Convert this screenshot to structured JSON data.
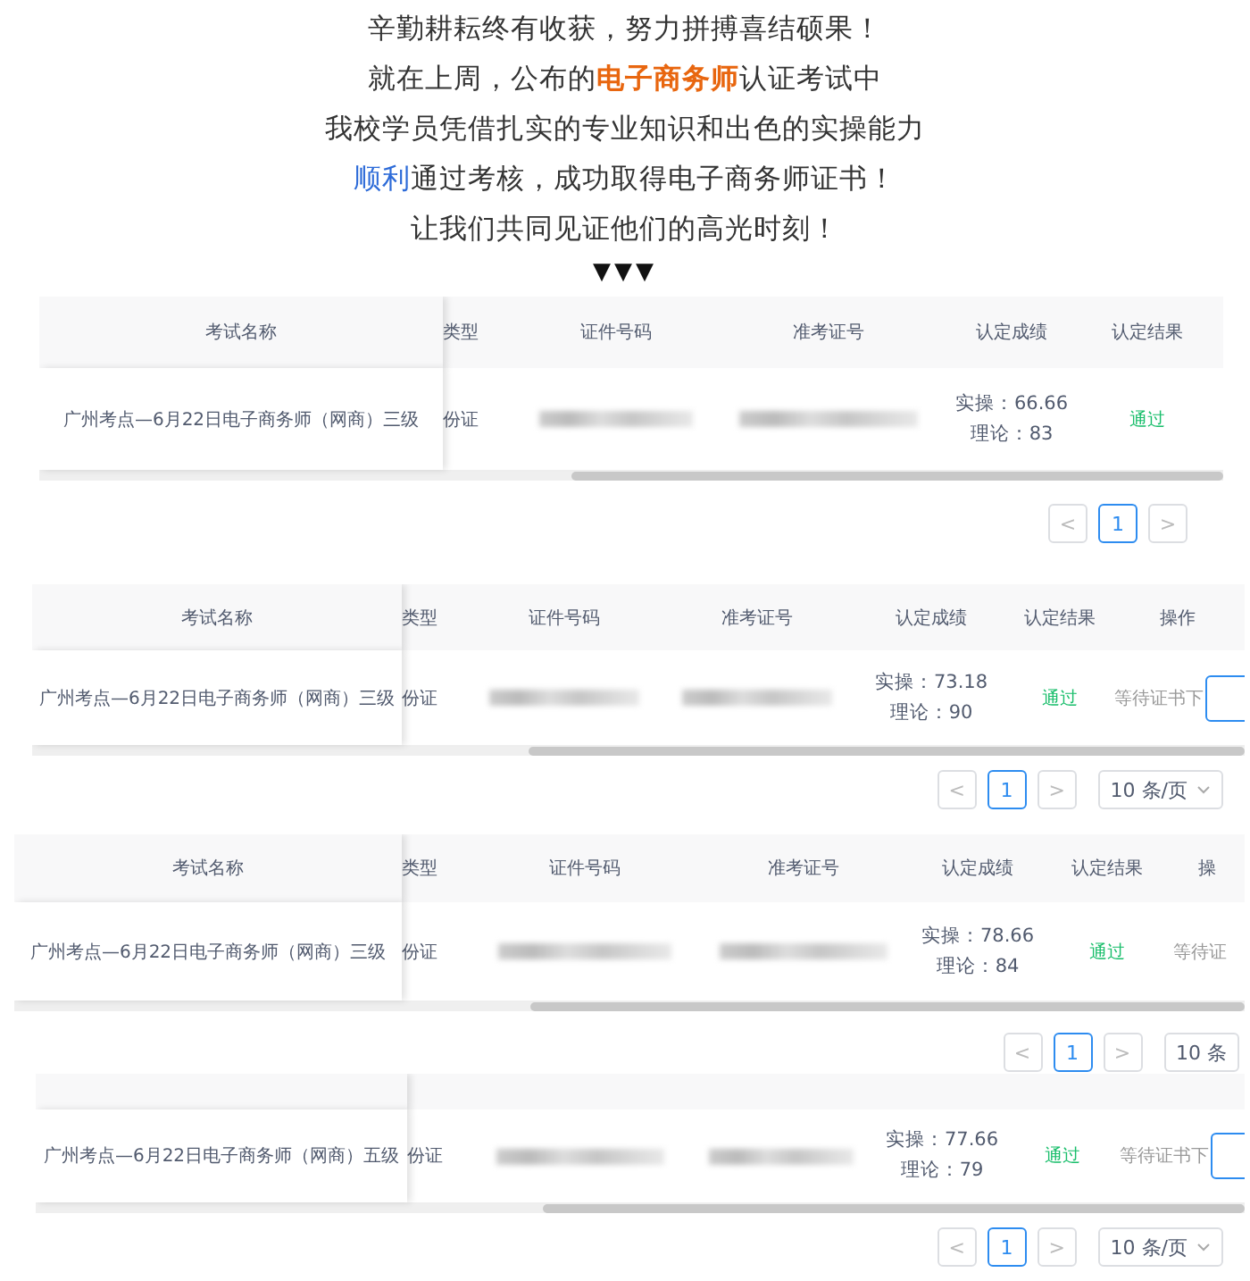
{
  "headline": {
    "lines": [
      [
        {
          "kind": "plain",
          "text": "辛勤耕耘终有收获，努力拼搏喜结硕果！"
        }
      ],
      [
        {
          "kind": "plain",
          "text": "就在上周，公布的"
        },
        {
          "kind": "accent",
          "text": "电子商务师"
        },
        {
          "kind": "plain",
          "text": "认证考试中"
        }
      ],
      [
        {
          "kind": "plain",
          "text": "我校学员凭借扎实的专业知识和出色的实操能力"
        }
      ],
      [
        {
          "kind": "link",
          "text": "顺利"
        },
        {
          "kind": "plain",
          "text": "通过考核，成功取得电子商务师证书！"
        }
      ],
      [
        {
          "kind": "plain",
          "text": "让我们共同见证他们的高光时刻！"
        }
      ]
    ],
    "arrows": "▼▼▼"
  },
  "records": [
    {
      "columns": [
        "考试名称",
        "类型",
        "证件号码",
        "准考证号",
        "认定成绩",
        "认定结果"
      ],
      "cells": [
        {
          "kind": "text",
          "text": "广州考点—6月22日电子商务师（网商）三级"
        },
        {
          "kind": "text",
          "text": "份证"
        },
        {
          "kind": "redacted"
        },
        {
          "kind": "redacted"
        },
        {
          "kind": "score",
          "lines": [
            "实操：66.66",
            "理论：83"
          ]
        },
        {
          "kind": "status",
          "text": "通过"
        }
      ],
      "pager": {
        "prev": "<",
        "pages": [
          {
            "label": "1",
            "selected": true
          }
        ],
        "next": ">"
      }
    },
    {
      "columns": [
        "考试名称",
        "类型",
        "证件号码",
        "准考证号",
        "认定成绩",
        "认定结果",
        "操作"
      ],
      "cells": [
        {
          "kind": "text",
          "text": "广州考点—6月22日电子商务师（网商）三级"
        },
        {
          "kind": "text",
          "text": "份证"
        },
        {
          "kind": "redacted"
        },
        {
          "kind": "redacted"
        },
        {
          "kind": "score",
          "lines": [
            "实操：73.18",
            "理论：90"
          ]
        },
        {
          "kind": "status",
          "text": "通过"
        },
        {
          "kind": "action",
          "text": "等待证书下"
        }
      ],
      "pager": {
        "prev": "<",
        "pages": [
          {
            "label": "1",
            "selected": true
          }
        ],
        "next": ">",
        "page_size": "10 条/页"
      }
    },
    {
      "columns": [
        "考试名称",
        "类型",
        "证件号码",
        "准考证号",
        "认定成绩",
        "认定结果",
        "操"
      ],
      "cells": [
        {
          "kind": "text",
          "text": "广州考点—6月22日电子商务师（网商）三级"
        },
        {
          "kind": "text",
          "text": "份证"
        },
        {
          "kind": "redacted"
        },
        {
          "kind": "redacted"
        },
        {
          "kind": "score",
          "lines": [
            "实操：78.66",
            "理论：84"
          ]
        },
        {
          "kind": "status",
          "text": "通过"
        },
        {
          "kind": "action",
          "text": "等待证"
        }
      ],
      "pager": {
        "prev": "<",
        "pages": [
          {
            "label": "1",
            "selected": true
          }
        ],
        "next": ">",
        "page_size": "10 条"
      }
    },
    {
      "cells": [
        {
          "kind": "text",
          "text": "广州考点—6月22日电子商务师（网商）五级"
        },
        {
          "kind": "text",
          "text": "份证"
        },
        {
          "kind": "redacted"
        },
        {
          "kind": "redacted"
        },
        {
          "kind": "score",
          "lines": [
            "实操：77.66",
            "理论：79"
          ]
        },
        {
          "kind": "status",
          "text": "通过"
        },
        {
          "kind": "action",
          "text": "等待证书下"
        }
      ],
      "pager": {
        "prev": "<",
        "pages": [
          {
            "label": "1",
            "selected": true
          }
        ],
        "next": ">",
        "page_size": "10 条/页"
      }
    }
  ]
}
